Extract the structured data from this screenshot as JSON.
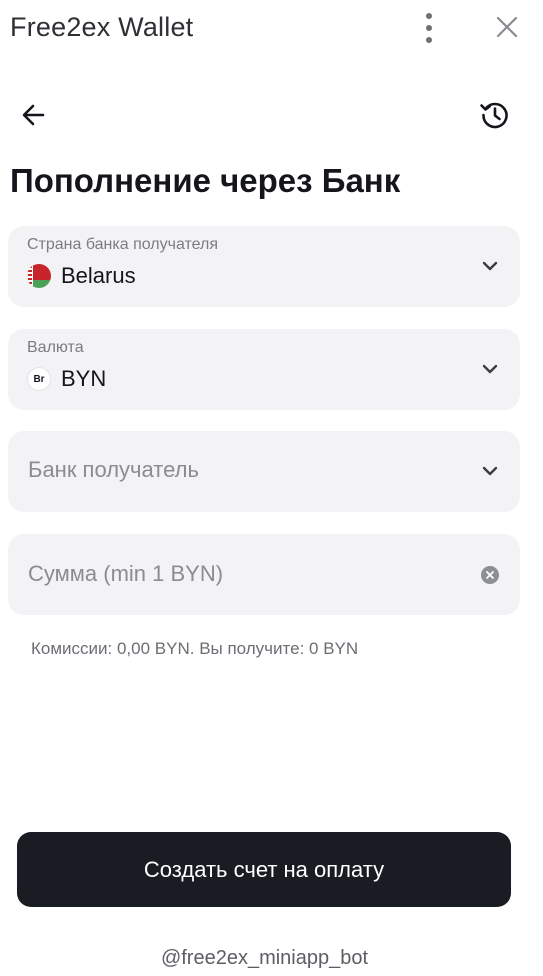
{
  "titlebar": {
    "app_title": "Free2ex Wallet"
  },
  "nav": {
    "back_icon": "arrow-left-icon",
    "history_icon": "history-icon"
  },
  "page": {
    "heading": "Пополнение через Банк"
  },
  "form": {
    "country": {
      "label": "Страна банка получателя",
      "value": "Belarus",
      "icon": "belarus-flag-icon"
    },
    "currency": {
      "label": "Валюта",
      "value": "BYN",
      "badge": "Br"
    },
    "bank": {
      "placeholder": "Банк получатель"
    },
    "amount": {
      "placeholder": "Сумма (min 1 BYN)",
      "value": ""
    },
    "fees_text": "Комиссии: 0,00 BYN. Вы получите: 0 BYN",
    "submit_label": "Создать счет на оплату"
  },
  "footer": {
    "bot_handle": "@free2ex_miniapp_bot"
  },
  "colors": {
    "field_bg": "#f3f3f6",
    "button_bg": "#1a1c23",
    "text_primary": "#14161c",
    "text_muted": "#7a7c82"
  }
}
